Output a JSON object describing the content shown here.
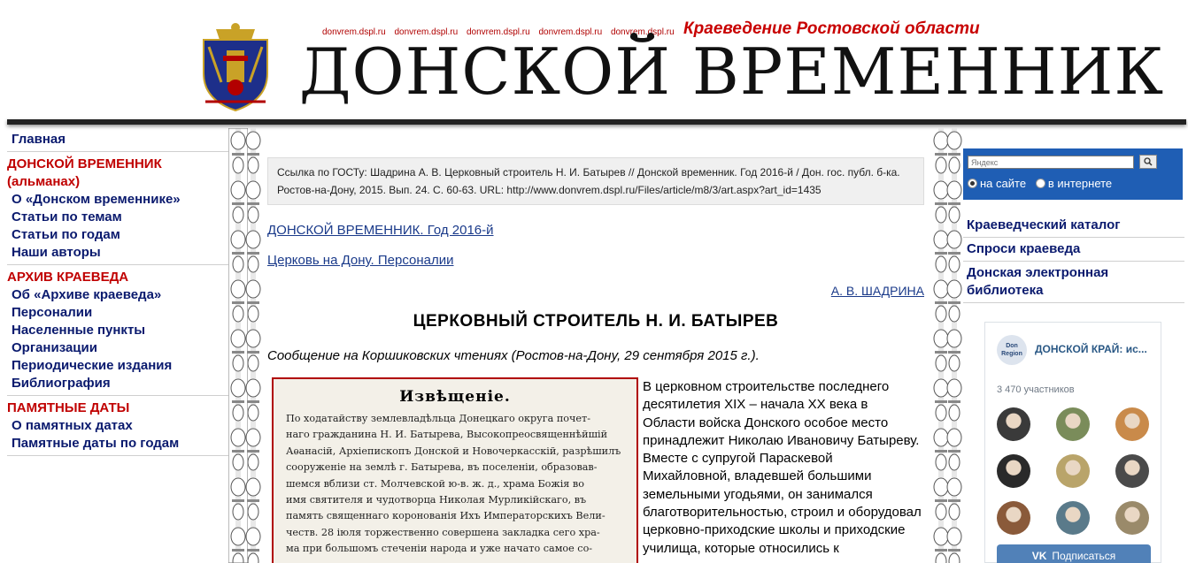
{
  "header": {
    "urls": [
      "donvrem.dspl.ru",
      "donvrem.dspl.ru",
      "donvrem.dspl.ru",
      "donvrem.dspl.ru",
      "donvrem.dspl.ru"
    ],
    "tagline": "Краеведение Ростовской области",
    "logo_text": "ДОНСКОЙ ВРЕМЕННИК"
  },
  "leftnav": {
    "home": "Главная",
    "section1_title": "ДОНСКОЙ ВРЕМЕННИК (альманах)",
    "section1_items": [
      "О «Донском временнике»",
      "Статьи по темам",
      "Статьи по годам",
      "Наши авторы"
    ],
    "section2_title": "АРХИВ КРАЕВЕДА",
    "section2_items": [
      "Об «Архиве краеведа»",
      "Персоналии",
      "Населенные пункты",
      "Организации",
      "Периодические издания",
      "Библиография"
    ],
    "section3_title": "ПАМЯТНЫЕ ДАТЫ",
    "section3_items": [
      "О памятных датах",
      "Памятные даты по годам"
    ]
  },
  "main": {
    "citation": "Ссылка по ГОСТу: Шадрина А. В. Церковный строитель Н. И. Батырев // Донской временник. Год 2016-й / Дон. гос. публ. б-ка. Ростов-на-Дону, 2015. Вып. 24. С. 60-63. URL: http://www.donvrem.dspl.ru/Files/article/m8/3/art.aspx?art_id=1435",
    "crumb1": "ДОНСКОЙ ВРЕМЕННИК. Год 2016-й",
    "crumb2": "Церковь на Дону. Персоналии",
    "author": "А. В. ШАДРИНА",
    "title": "ЦЕРКОВНЫЙ СТРОИТЕЛЬ Н. И. БАТЫРЕВ",
    "subtitle": "Сообщение на Коршиковских чтениях (Ростов-на-Дону, 29 сентября 2015 г.).",
    "scan_heading": "Извѣщеніе.",
    "scan_lines": [
      "По ходатайству землевладѣльца Донецкаго округа почет-",
      "наго гражданина Н. И. Батырева, Высокопреосвященнѣйшій",
      "Аѳанасій, Архіепископъ Донской и Новочеркасскій, разрѣшилъ",
      "сооруженіе на землѣ г. Батырева, въ поселеніи, образовав-",
      "шемся вблизи ст. Молчевской ю-в. ж. д., храма Божія во",
      "имя святителя и чудотворца Николая Мурликійскаго, въ",
      "память священнаго коронованія Ихъ Императорскихъ Вели-",
      "честв. 28 іюля торжественно совершена закладка сего хра-",
      "ма при большомъ стеченіи народа и уже начато самое со-"
    ],
    "body_text": "В церковном строительстве последнего десятилетия XIX – начала XX века в Области войска Донского особое место принадлежит Николаю Ивановичу Батыреву. Вместе с супругой Параскевой Михайловной, владевшей большими земельными угодьями, он занимался благотворительностью, строил и оборудовал церковно-приходские школы и приходские училища, которые относились к"
  },
  "search": {
    "placeholder": "Яндекс",
    "button_icon": "magnifier-icon",
    "option_site": "на сайте",
    "option_web": "в интернете"
  },
  "rightnav": {
    "items": [
      "Краеведческий каталог",
      "Спроси краеведа",
      "Донская электронная библиотека"
    ]
  },
  "vk": {
    "logo_text": "Don Region",
    "group_name": "ДОНСКОЙ КРАЙ: ис...",
    "members": "3 470 участников",
    "subscribe": "Подписаться",
    "avatar_colors": [
      "#3a3a3a",
      "#7a8c5a",
      "#c98a4a",
      "#2a2a2a",
      "#b9a46a",
      "#4a4a4a",
      "#8a5a3a",
      "#5a7a8a",
      "#9a8a6a"
    ],
    "accent": "#5181b8"
  }
}
